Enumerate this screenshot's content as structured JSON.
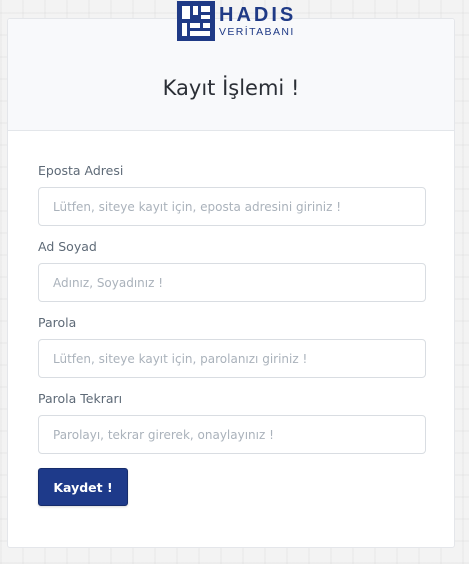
{
  "logo": {
    "title": "HADIS",
    "subtitle": "VERİTABANI"
  },
  "form": {
    "title": "Kayıt İşlemi !",
    "fields": [
      {
        "label": "Eposta Adresi",
        "placeholder": "Lütfen, siteye kayıt için, eposta adresini giriniz !",
        "value": ""
      },
      {
        "label": "Ad Soyad",
        "placeholder": "Adınız, Soyadınız !",
        "value": ""
      },
      {
        "label": "Parola",
        "placeholder": "Lütfen, siteye kayıt için, parolanızı giriniz !",
        "value": ""
      },
      {
        "label": "Parola Tekrarı",
        "placeholder": "Parolayı, tekrar girerek, onaylayınız !",
        "value": ""
      }
    ],
    "submit_label": "Kaydet !"
  },
  "colors": {
    "brand": "#1e3a8a",
    "background": "#f3f3f3"
  }
}
